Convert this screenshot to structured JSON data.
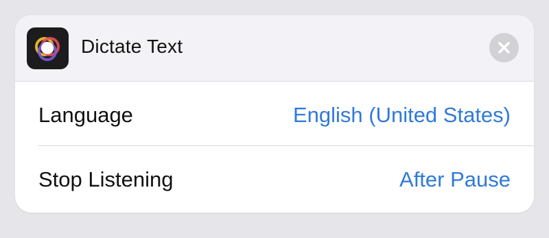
{
  "action": {
    "title": "Dictate Text",
    "icon": "dictate-app-icon",
    "close_icon": "close-icon"
  },
  "parameters": [
    {
      "label": "Language",
      "value": "English (United States)"
    },
    {
      "label": "Stop Listening",
      "value": "After Pause"
    }
  ],
  "colors": {
    "accent": "#2f7ad8",
    "header_bg": "#f2f2f7",
    "close_bg": "#d1d1d6"
  }
}
